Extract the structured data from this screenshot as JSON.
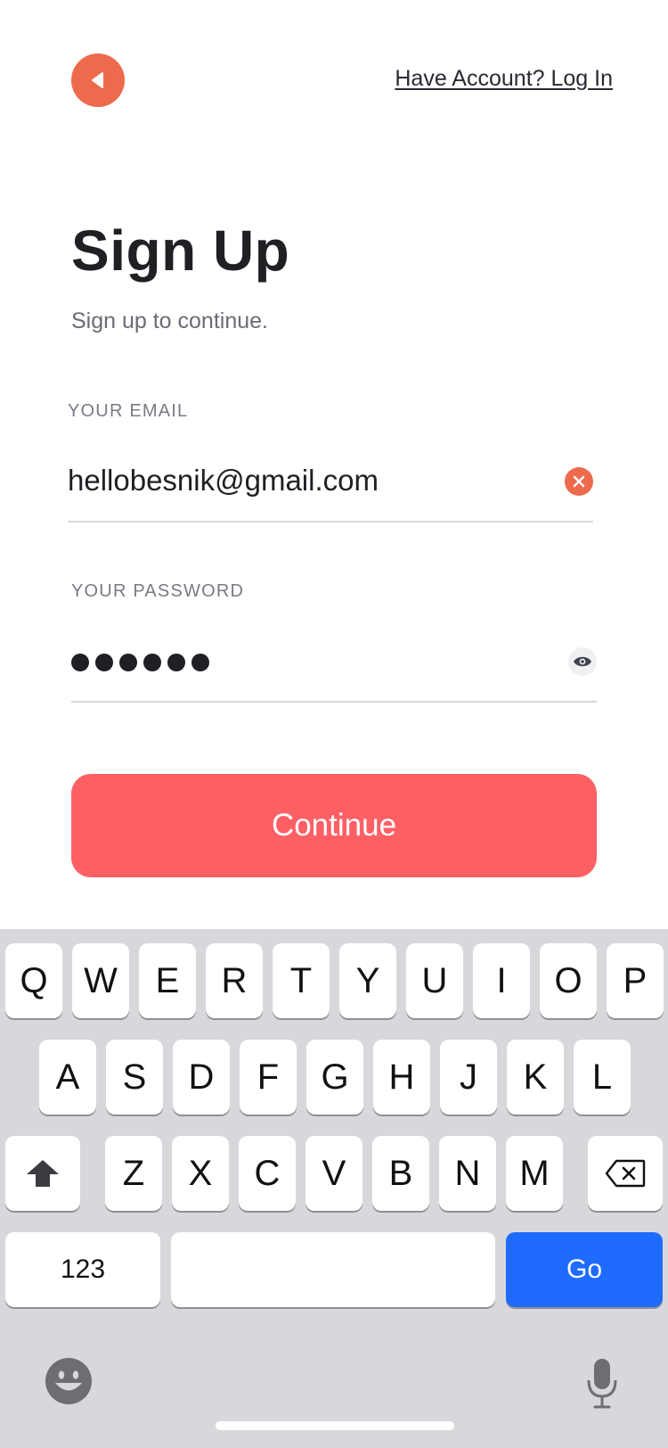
{
  "header": {
    "back_icon": "back-arrow-icon",
    "login_link": "Have Account? Log In"
  },
  "title": "Sign Up",
  "subtitle": "Sign up to continue.",
  "email": {
    "label": "YOUR EMAIL",
    "value": "hellobesnik@gmail.com",
    "clear_icon": "clear-icon"
  },
  "password": {
    "label": "YOUR PASSWORD",
    "masked_length": 6,
    "visibility_icon": "eye-icon"
  },
  "continue_label": "Continue",
  "colors": {
    "accent": "#ee6a4d",
    "button": "#fc6065",
    "keyboard_go": "#1f6bff"
  },
  "keyboard": {
    "row1": [
      "Q",
      "W",
      "E",
      "R",
      "T",
      "Y",
      "U",
      "I",
      "O",
      "P"
    ],
    "row2": [
      "A",
      "S",
      "D",
      "F",
      "G",
      "H",
      "J",
      "K",
      "L"
    ],
    "row3": [
      "Z",
      "X",
      "C",
      "V",
      "B",
      "N",
      "M"
    ],
    "numbers_label": "123",
    "go_label": "Go",
    "shift_icon": "shift-icon",
    "backspace_icon": "backspace-icon",
    "emoji_icon": "emoji-icon",
    "mic_icon": "microphone-icon"
  }
}
